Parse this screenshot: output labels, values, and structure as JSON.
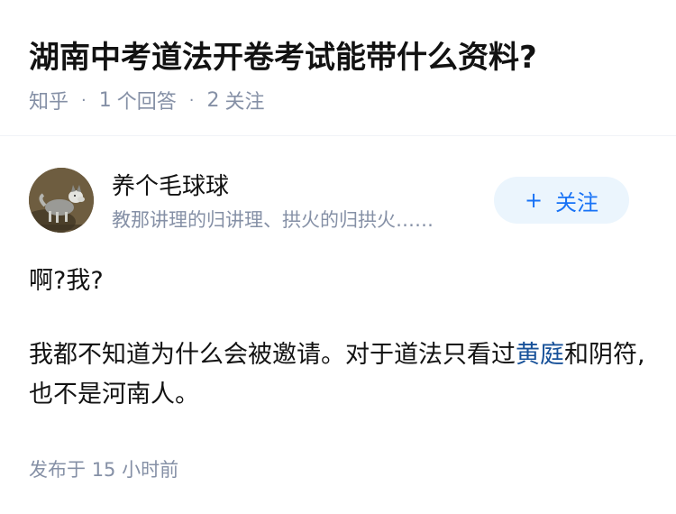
{
  "question": {
    "title": "湖南中考道法开卷考试能带什么资料?",
    "source": "知乎",
    "answers_count": "1",
    "answers_label": "个回答",
    "followers_count": "2",
    "followers_label": "关注"
  },
  "author": {
    "name": "养个毛球球",
    "bio": "教那讲理的归讲理、拱火的归拱火……",
    "follow_label": "关注",
    "follow_icon": "plus-icon"
  },
  "answer": {
    "paragraph1": "啊?我?",
    "paragraph2_before_link": "我都不知道为什么会被邀请。对于道法只看过",
    "paragraph2_link": "黄庭",
    "paragraph2_after_link": "和阴符,也不是河南人。",
    "published_label": "发布于",
    "published_value": "15 小时前"
  },
  "colors": {
    "title": "#121212",
    "meta": "#8590a6",
    "accent": "#1772f6",
    "follow_bg": "#ebf5fd",
    "link": "#175199"
  }
}
